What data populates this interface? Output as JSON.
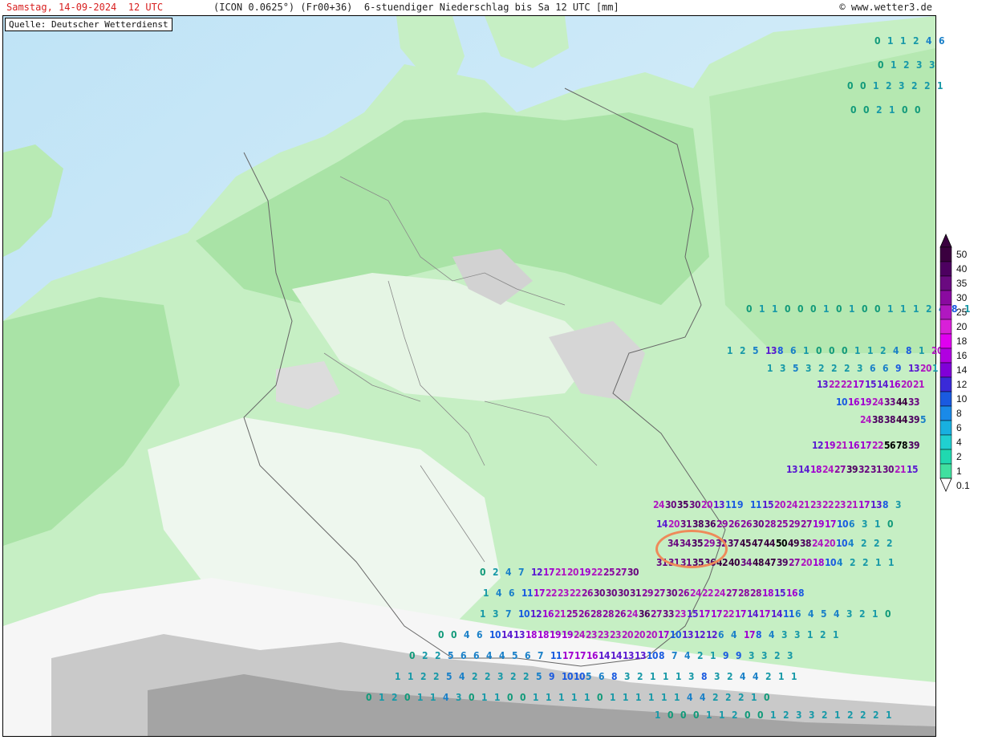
{
  "header": {
    "date_label": "Samstag, 14-09-2024  12 UTC",
    "model_label": "(ICON 0.0625°) (Fr00+36)  6-stuendiger Niederschlag bis Sa 12 UTC [mm]",
    "copyright": "© www.wetter3.de"
  },
  "source_label": "Quelle: Deutscher Wetterdienst",
  "colors": {
    "sea": "#cfe9f7",
    "land": "#c6efc4",
    "land_mid": "#a9e3a6",
    "land_dark": "#8fd88c",
    "terrain_white": "#f6f6f6",
    "terrain_grey": "#c4c4c4",
    "terrain_dark": "#9a9a9a",
    "callout": "#ee8a5a"
  },
  "legend": {
    "labels": [
      "50",
      "40",
      "35",
      "30",
      "25",
      "20",
      "18",
      "16",
      "14",
      "12",
      "10",
      "8",
      "6",
      "4",
      "2",
      "1",
      "0.1"
    ],
    "colors": [
      "#3a003f",
      "#4d0060",
      "#6a0a80",
      "#8a0aa0",
      "#b018c0",
      "#d820d8",
      "#e000f0",
      "#b000e0",
      "#8000d8",
      "#3a2ad8",
      "#1a5ae0",
      "#1a8ae8",
      "#18b0e0",
      "#20d0d0",
      "#20d8b0",
      "#40e0a0",
      "#a0f0d0"
    ]
  },
  "value_rows": [
    {
      "row": 1,
      "values": "0 1 1 2 4 6"
    },
    {
      "row": 2,
      "values": "0 1 2 3 3"
    },
    {
      "row": 3,
      "values": "0 0 1 2 3 2 2 1"
    },
    {
      "row": 4,
      "values": "0 0 2 1 0 0"
    },
    {
      "row": 5,
      "values": "0 1 1 0 0 0 1 0 1 0 0 1 1 1 2 4 8 1"
    },
    {
      "row": 6,
      "values": "1 2 5 13 8 6 1 0 0 0 1 1 2 4 8 1 20 1"
    },
    {
      "row": 7,
      "values": "1 3 5 3 2 2 2 3 6 6 9 13 20 1"
    },
    {
      "row": 8,
      "values": "13 22 22 17 15 14 16 20 21"
    },
    {
      "row": 9,
      "values": "10 16 19 24 33 44 33"
    },
    {
      "row": 10,
      "values": "24 38 38 44 39 5"
    },
    {
      "row": 11,
      "values": "12 19 21 16 17 22 56 78 39"
    },
    {
      "row": 12,
      "values": "13 14 18 24 27 39 32 31 30 21 15"
    },
    {
      "row": 13,
      "values": "24 30 35 30 20 13 11 9 11 15 20 24 21 23 22 23 21 17 13 8 3"
    },
    {
      "row": 14,
      "values": "14 20 31 38 36 29 26 26 30 28 25 29 27 19 17 10 6 3 1 0"
    },
    {
      "row": 15,
      "values": "34 34 35 29 32 37 45 47 44 50 49 38 24 20 10 4 2 2 2"
    },
    {
      "row": 16,
      "values": "31 31 31 35 36 42 40 34 48 47 39 27 20 18 10 4 2 2 1 1"
    },
    {
      "row": 17,
      "values": "0 2 4 7 12 17 21 20 19 22 25 27 30"
    },
    {
      "row": 18,
      "values": "1 4 6 11 17 22 23 22 26 30 30 30 31 29 27 30 26 24 22 24 27 28 28 18 15 16 8"
    },
    {
      "row": 19,
      "values": "1 3 7 10 12 16 21 25 26 28 28 26 24 36 27 33 23 15 17 17 22 17 14 17 14 11 6 4 5 4 3 2 1 0"
    },
    {
      "row": 20,
      "values": "0 0 4 6 10 14 13 18 18 19 19 24 23 23 23 20 20 20 17 10 13 12 12 6 4 17 8 4 3 3 1 2 1"
    },
    {
      "row": 21,
      "values": "0 2 2 5 6 6 4 4 5 6 7 11 17 17 16 14 14 13 13 10 8 7 4 2 1 9 9 3 3 2 3"
    },
    {
      "row": 22,
      "values": "1 1 2 2 5 4 2 2 3 2 2 5 9 10 10 5 6 8 3 2 1 1 1 3 8 3 2 4 4 2 1 1"
    },
    {
      "row": 23,
      "values": "0 1 2 0 1 1 4 3 0 1 1 0 0 1 1 1 1 1 0 1 1 1 1 1 1 4 4 2 2 2 1 0"
    },
    {
      "row": 24,
      "values": "1 0 0 0 1 1 2 0 0 1 2 3 3 2 1 2 2 2 1"
    }
  ]
}
